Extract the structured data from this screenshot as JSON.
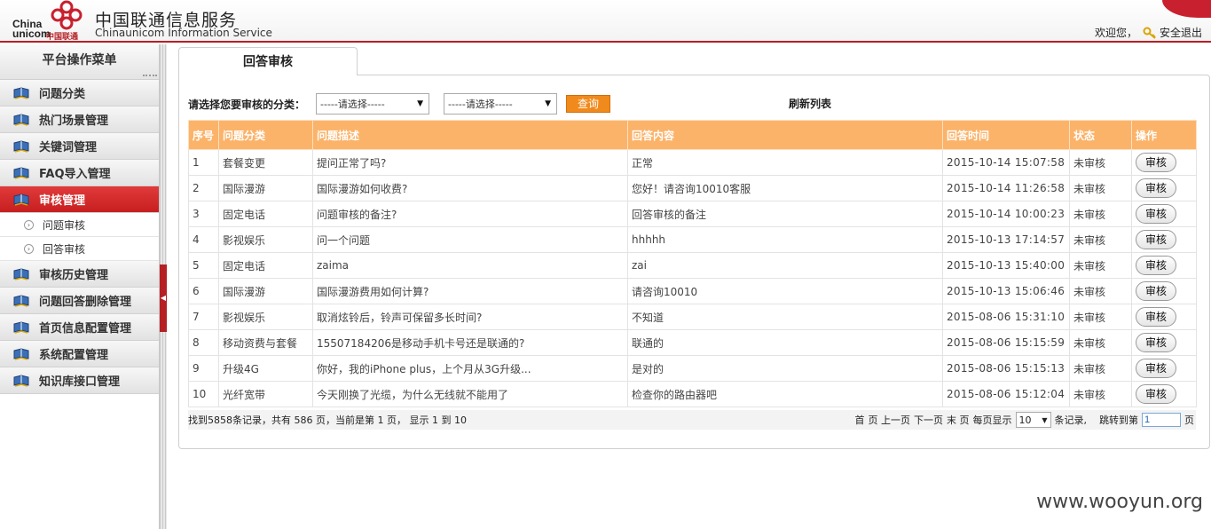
{
  "header": {
    "logo_en_line1": "China",
    "logo_en_line2": "unicom",
    "logo_cn": "中国联通",
    "brand_cn": "中国联通信息服务",
    "brand_en": "Chinaunicom Information Service",
    "greeting": "欢迎您，",
    "logout": "安全退出",
    "accent_color": "#b52025"
  },
  "sidebar": {
    "title": "平台操作菜单",
    "items": [
      {
        "label": "问题分类",
        "icon": "book-icon",
        "active": false
      },
      {
        "label": "热门场景管理",
        "icon": "book-icon",
        "active": false
      },
      {
        "label": "关键词管理",
        "icon": "book-icon",
        "active": false
      },
      {
        "label": "FAQ导入管理",
        "icon": "book-icon",
        "active": false
      },
      {
        "label": "审核管理",
        "icon": "book-icon",
        "active": true
      }
    ],
    "sub_items": [
      {
        "label": "问题审核"
      },
      {
        "label": "回答审核"
      }
    ],
    "items_after": [
      {
        "label": "审核历史管理",
        "icon": "book-icon"
      },
      {
        "label": "问题回答删除管理",
        "icon": "book-icon"
      },
      {
        "label": "首页信息配置管理",
        "icon": "book-icon"
      },
      {
        "label": "系统配置管理",
        "icon": "book-icon"
      },
      {
        "label": "知识库接口管理",
        "icon": "book-icon"
      }
    ]
  },
  "main": {
    "tab_label": "回答审核",
    "filter": {
      "label": "请选择您要审核的分类：",
      "select1": "-----请选择-----",
      "select2": "-----请选择-----",
      "query_button": "查询",
      "refresh": "刷新列表"
    },
    "table": {
      "columns": [
        "序号",
        "问题分类",
        "问题描述",
        "回答内容",
        "回答时间",
        "状态",
        "操作"
      ],
      "rows": [
        {
          "no": "1",
          "category": "套餐变更",
          "question": "提问正常了吗?",
          "answer": "正常",
          "time": "2015-10-14 15:07:58",
          "status": "未审核",
          "action": "审核"
        },
        {
          "no": "2",
          "category": "国际漫游",
          "question": "国际漫游如何收费?",
          "answer": "您好！请咨询10010客服",
          "time": "2015-10-14 11:26:58",
          "status": "未审核",
          "action": "审核"
        },
        {
          "no": "3",
          "category": "固定电话",
          "question": "问题审核的备注?",
          "answer": "回答审核的备注",
          "time": "2015-10-14 10:00:23",
          "status": "未审核",
          "action": "审核"
        },
        {
          "no": "4",
          "category": "影视娱乐",
          "question": "问一个问题",
          "answer": "hhhhh",
          "time": "2015-10-13 17:14:57",
          "status": "未审核",
          "action": "审核"
        },
        {
          "no": "5",
          "category": "固定电话",
          "question": "zaima",
          "answer": "zai",
          "time": "2015-10-13 15:40:00",
          "status": "未审核",
          "action": "审核"
        },
        {
          "no": "6",
          "category": "国际漫游",
          "question": "国际漫游费用如何计算?",
          "answer": "请咨询10010",
          "time": "2015-10-13 15:06:46",
          "status": "未审核",
          "action": "审核"
        },
        {
          "no": "7",
          "category": "影视娱乐",
          "question": "取消炫铃后，铃声可保留多长时间?",
          "answer": "不知道",
          "time": "2015-08-06 15:31:10",
          "status": "未审核",
          "action": "审核"
        },
        {
          "no": "8",
          "category": "移动资费与套餐",
          "question": "15507184206是移动手机卡号还是联通的?",
          "answer": "联通的",
          "time": "2015-08-06 15:15:59",
          "status": "未审核",
          "action": "审核"
        },
        {
          "no": "9",
          "category": "升级4G",
          "question": "你好，我的iPhone plus，上个月从3G升级...",
          "answer": "是对的",
          "time": "2015-08-06 15:15:13",
          "status": "未审核",
          "action": "审核"
        },
        {
          "no": "10",
          "category": "光纤宽带",
          "question": "今天刚换了光缆，为什么无线就不能用了",
          "answer": "检查你的路由器吧",
          "time": "2015-08-06 15:12:04",
          "status": "未审核",
          "action": "审核"
        }
      ]
    },
    "pager": {
      "summary": "找到5858条记录，共有 586 页，当前是第 1 页， 显示 1 到 10",
      "first": "首",
      "prev": "页 上一页",
      "next": "下一页",
      "last": "末 页",
      "page_size_label": "每页显示",
      "page_size": "10",
      "records_suffix": "条记录,",
      "jump_label": "跳转到第",
      "jump_value": "1",
      "jump_suffix": "页"
    }
  },
  "watermark": "www.wooyun.org"
}
